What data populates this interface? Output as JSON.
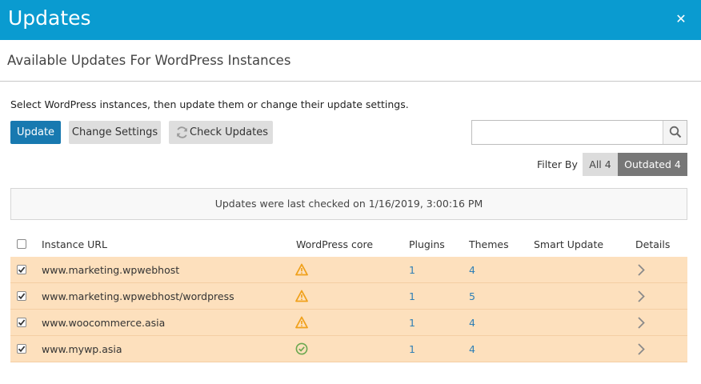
{
  "dialog": {
    "title": "Updates",
    "close_symbol": "✕",
    "subtitle": "Available Updates For WordPress Instances"
  },
  "intro_text": "Select WordPress instances, then update them or change their update settings.",
  "toolbar": {
    "update_label": "Update",
    "change_settings_label": "Change Settings",
    "check_updates_label": "Check Updates",
    "check_updates_icon": "refresh-icon"
  },
  "search": {
    "value": "",
    "placeholder": "",
    "icon": "search-icon"
  },
  "filter": {
    "label": "Filter By",
    "all_label": "All 4",
    "outdated_label": "Outdated 4",
    "selected": "Outdated 4"
  },
  "notice": "Updates were last checked on 1/16/2019, 3:00:16 PM",
  "table": {
    "columns": [
      "Instance URL",
      "WordPress core",
      "Plugins",
      "Themes",
      "Smart Update",
      "Details"
    ],
    "header_checked": false,
    "rows": [
      {
        "checked": true,
        "url": "www.marketing.wpwebhost",
        "core_status": "warning-icon",
        "plugins": "1",
        "themes": "4",
        "smart_update": ""
      },
      {
        "checked": true,
        "url": "www.marketing.wpwebhost/wordpress",
        "core_status": "warning-icon",
        "plugins": "1",
        "themes": "5",
        "smart_update": ""
      },
      {
        "checked": true,
        "url": "www.woocommerce.asia",
        "core_status": "warning-icon",
        "plugins": "1",
        "themes": "4",
        "smart_update": ""
      },
      {
        "checked": true,
        "url": "www.mywp.asia",
        "core_status": "ok-check-icon",
        "plugins": "1",
        "themes": "4",
        "smart_update": ""
      }
    ]
  },
  "colors": {
    "titlebar": "#0a9bd0",
    "primary_button": "#1879b0",
    "row_highlight": "#fde0bd",
    "warning": "#f0a11c",
    "ok": "#6aa84f",
    "link": "#2f7fb5"
  }
}
